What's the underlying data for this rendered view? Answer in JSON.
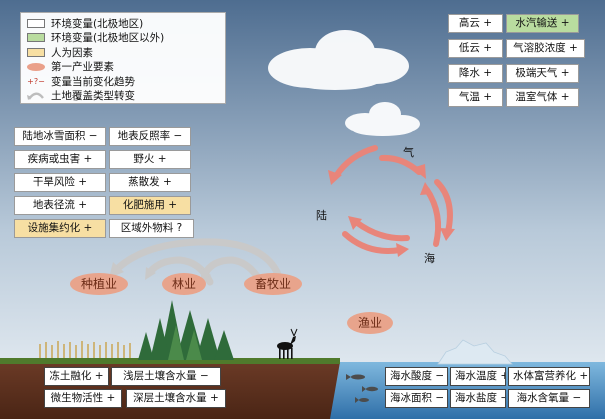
{
  "legend": {
    "items": [
      {
        "text": "环境变量(北极地区)",
        "symbol": "white-box"
      },
      {
        "text": "环境变量(北极地区以外)",
        "symbol": "green-box"
      },
      {
        "text": "人为因素",
        "symbol": "yellow-box"
      },
      {
        "text": "第一产业要素",
        "symbol": "salmon-oval"
      },
      {
        "text": "变量当前变化趋势",
        "symbol": "+?−"
      },
      {
        "text": "土地覆盖类型转变",
        "symbol": "gray-arc-arrow"
      }
    ]
  },
  "atmosphere": [
    {
      "text": "高云 +"
    },
    {
      "text": "水汽输送 +"
    },
    {
      "text": "低云 +"
    },
    {
      "text": "气溶胶浓度 +"
    },
    {
      "text": "降水 +"
    },
    {
      "text": "极端天气 +"
    },
    {
      "text": "气温 +"
    },
    {
      "text": "温室气体 +"
    }
  ],
  "land_left": [
    {
      "text": "陆地冰雪面积 −"
    },
    {
      "text": "地表反照率 −"
    },
    {
      "text": "疾病或虫害 +"
    },
    {
      "text": "野火 +"
    },
    {
      "text": "干旱风险 +"
    },
    {
      "text": "蒸散发 +"
    },
    {
      "text": "地表径流 +"
    },
    {
      "text": "化肥施用 +"
    },
    {
      "text": "设施集约化 +"
    },
    {
      "text": "区域外物料 ?"
    }
  ],
  "cycle": {
    "qi": "气",
    "lu": "陆",
    "hai": "海"
  },
  "sectors": {
    "planting": "种植业",
    "forestry": "林业",
    "livestock": "畜牧业",
    "fishery": "渔业"
  },
  "soil": [
    {
      "text": "冻土融化 +"
    },
    {
      "text": "浅层土壤含水量 −"
    },
    {
      "text": "微生物活性 +"
    },
    {
      "text": "深层土壤含水量 +"
    }
  ],
  "ocean": [
    {
      "text": "海水酸度 −"
    },
    {
      "text": "海水温度 +"
    },
    {
      "text": "水体富营养化 +"
    },
    {
      "text": "海冰面积 −"
    },
    {
      "text": "海水盐度 −"
    },
    {
      "text": "海水含氧量 −"
    }
  ],
  "colors": {
    "sky_top": "#4e6d90",
    "sky_bottom": "#eef3f7",
    "arrow": "#e8857a",
    "env_outside": "#b9dc9f",
    "human": "#f7dfa3",
    "sector": "#e8a48c"
  }
}
